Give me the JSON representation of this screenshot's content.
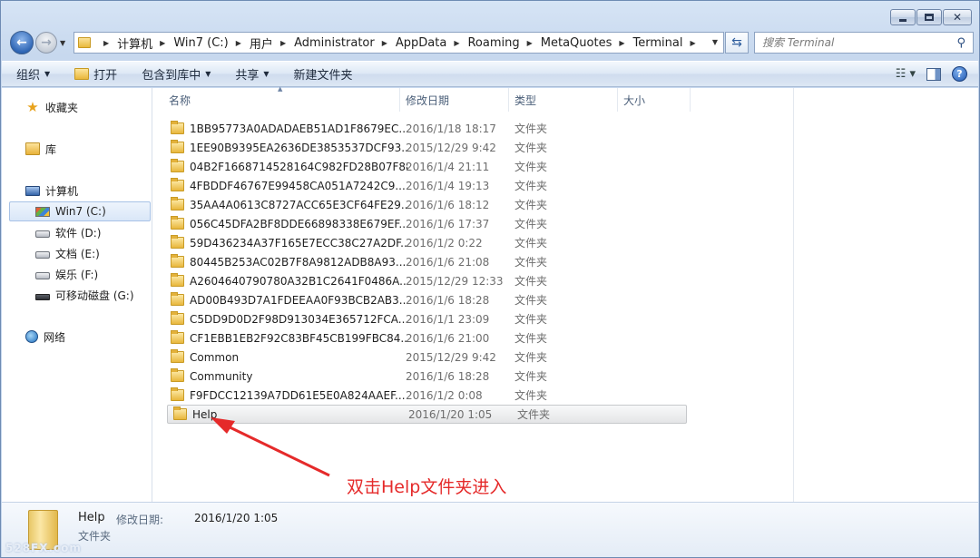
{
  "breadcrumb": [
    "计算机",
    "Win7 (C:)",
    "用户",
    "Administrator",
    "AppData",
    "Roaming",
    "MetaQuotes",
    "Terminal"
  ],
  "search": {
    "placeholder": "搜索 Terminal"
  },
  "toolbar": {
    "organize": "组织",
    "open": "打开",
    "include_in_library": "包含到库中",
    "share": "共享",
    "new_folder": "新建文件夹"
  },
  "nav": {
    "favorites": "收藏夹",
    "libraries": "库",
    "computer": "计算机",
    "drives": [
      {
        "label": "Win7 (C:)",
        "icon": "windows-drive-icon",
        "selected": true
      },
      {
        "label": "软件 (D:)",
        "icon": "hard-drive-icon"
      },
      {
        "label": "文档 (E:)",
        "icon": "hard-drive-icon"
      },
      {
        "label": "娱乐 (F:)",
        "icon": "hard-drive-icon"
      },
      {
        "label": "可移动磁盘 (G:)",
        "icon": "removable-drive-icon"
      }
    ],
    "network": "网络"
  },
  "columns": {
    "name": "名称",
    "date": "修改日期",
    "type": "类型",
    "size": "大小"
  },
  "files": [
    {
      "name": "1BB95773A0ADADAEB51AD1F8679EC...",
      "date": "2016/1/18 18:17",
      "type": "文件夹"
    },
    {
      "name": "1EE90B9395EA2636DE3853537DCF93...",
      "date": "2015/12/29 9:42",
      "type": "文件夹"
    },
    {
      "name": "04B2F1668714528164C982FD28B07F88",
      "date": "2016/1/4 21:11",
      "type": "文件夹"
    },
    {
      "name": "4FBDDF46767E99458CA051A7242C9...",
      "date": "2016/1/4 19:13",
      "type": "文件夹"
    },
    {
      "name": "35AA4A0613C8727ACC65E3CF64FE29...",
      "date": "2016/1/6 18:12",
      "type": "文件夹"
    },
    {
      "name": "056C45DFA2BF8DDE66898338E679EF...",
      "date": "2016/1/6 17:37",
      "type": "文件夹"
    },
    {
      "name": "59D436234A37F165E7ECC38C27A2DF...",
      "date": "2016/1/2 0:22",
      "type": "文件夹"
    },
    {
      "name": "80445B253AC02B7F8A9812ADB8A93...",
      "date": "2016/1/6 21:08",
      "type": "文件夹"
    },
    {
      "name": "A2604640790780A32B1C2641F0486A...",
      "date": "2015/12/29 12:33",
      "type": "文件夹"
    },
    {
      "name": "AD00B493D7A1FDEEAA0F93BCB2AB3...",
      "date": "2016/1/6 18:28",
      "type": "文件夹"
    },
    {
      "name": "C5DD9D0D2F98D913034E365712FCA...",
      "date": "2016/1/1 23:09",
      "type": "文件夹"
    },
    {
      "name": "CF1EBB1EB2F92C83BF45CB199FBC84...",
      "date": "2016/1/6 21:00",
      "type": "文件夹"
    },
    {
      "name": "Common",
      "date": "2015/12/29 9:42",
      "type": "文件夹"
    },
    {
      "name": "Community",
      "date": "2016/1/6 18:28",
      "type": "文件夹"
    },
    {
      "name": "F9FDCC12139A7DD61E5E0A824AAEF...",
      "date": "2016/1/2 0:08",
      "type": "文件夹"
    },
    {
      "name": "Help",
      "date": "2016/1/20 1:05",
      "type": "文件夹",
      "selected": true
    }
  ],
  "annotation": "双击Help文件夹进入",
  "details": {
    "name": "Help",
    "date_label": "修改日期:",
    "date": "2016/1/20 1:05",
    "type": "文件夹",
    "watermark": "528FX.com"
  },
  "colors": {
    "accent": "#3363a9",
    "annotation": "#e52a2a",
    "folder": "#e8b73c"
  }
}
